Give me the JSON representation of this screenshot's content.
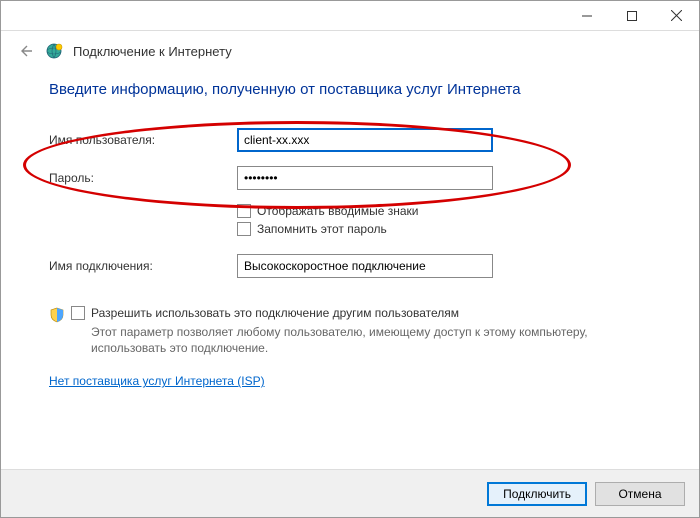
{
  "titlebar": {
    "minimize": "minimize",
    "maximize": "maximize",
    "close": "close"
  },
  "header": {
    "title": "Подключение к Интернету"
  },
  "main": {
    "heading": "Введите информацию, полученную от поставщика услуг Интернета",
    "username_label": "Имя пользователя:",
    "username_value": "client-xx.xxx",
    "password_label": "Пароль:",
    "password_value": "••••••••",
    "show_chars_label": "Отображать вводимые знаки",
    "remember_label": "Запомнить этот пароль",
    "connection_name_label": "Имя подключения:",
    "connection_name_value": "Высокоскоростное подключение",
    "allow_others_label": "Разрешить использовать это подключение другим пользователям",
    "allow_others_desc": "Этот параметр позволяет любому пользователю, имеющему доступ к этому компьютеру, использовать это подключение.",
    "isp_link": "Нет поставщика услуг Интернета (ISP)"
  },
  "footer": {
    "connect": "Подключить",
    "cancel": "Отмена"
  }
}
